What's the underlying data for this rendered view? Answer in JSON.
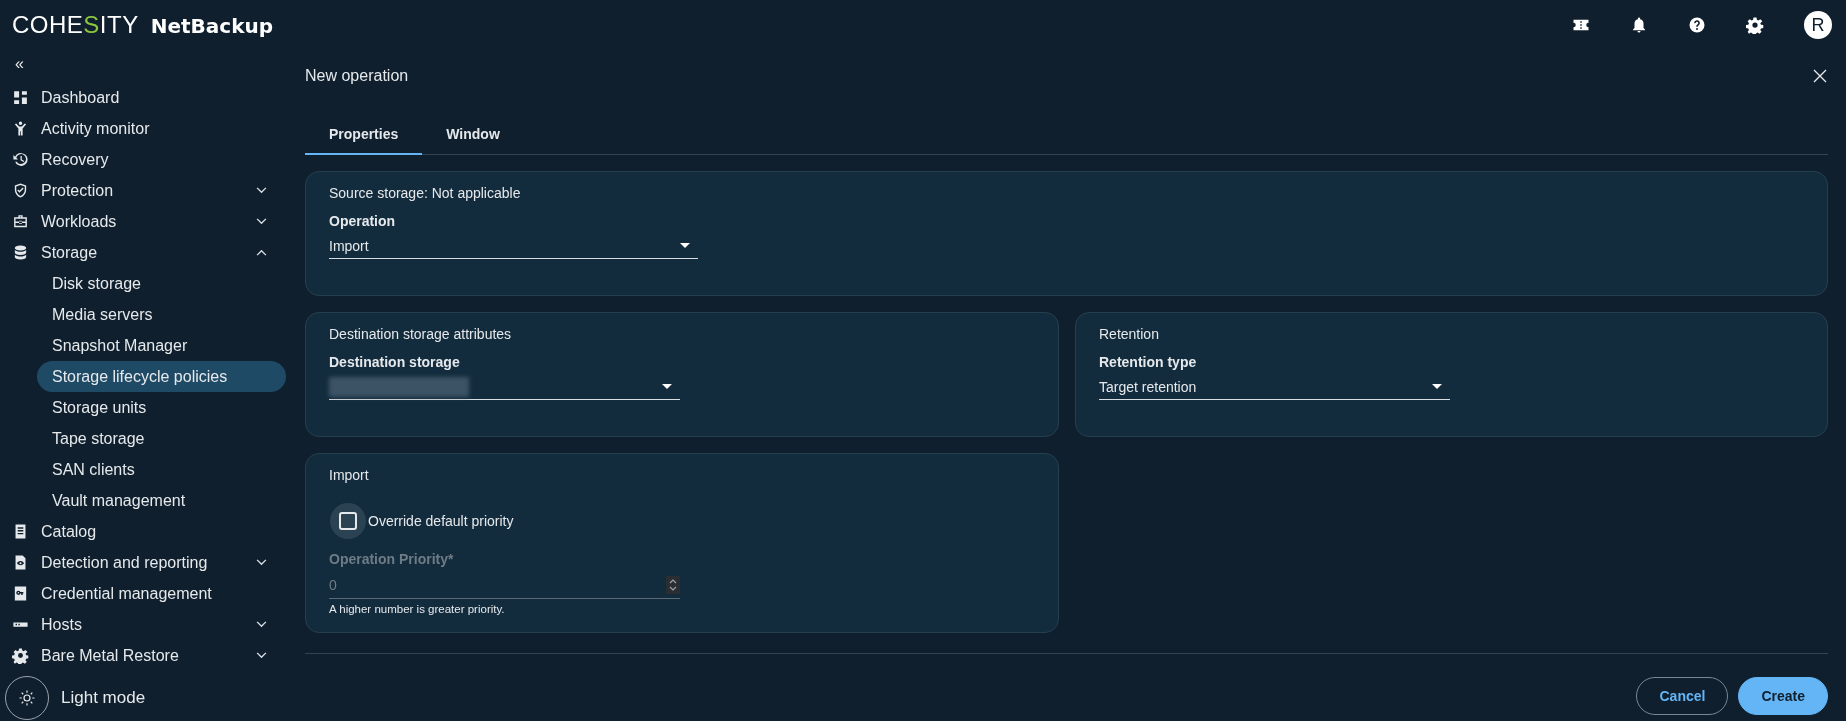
{
  "header": {
    "logo": "COHESITY",
    "product": "NetBackup",
    "avatar": "R"
  },
  "sidebar": {
    "collapse": "«",
    "items": [
      {
        "label": "Dashboard",
        "kind": "link",
        "selected": false
      },
      {
        "label": "Activity monitor",
        "kind": "link",
        "selected": false
      },
      {
        "label": "Recovery",
        "kind": "link",
        "selected": false
      },
      {
        "label": "Protection",
        "kind": "group",
        "expanded": false,
        "selected": false
      },
      {
        "label": "Workloads",
        "kind": "group",
        "expanded": false,
        "selected": false
      },
      {
        "label": "Storage",
        "kind": "group",
        "expanded": true,
        "selected": false,
        "children": [
          {
            "label": "Disk storage",
            "selected": false
          },
          {
            "label": "Media servers",
            "selected": false
          },
          {
            "label": "Snapshot Manager",
            "selected": false
          },
          {
            "label": "Storage lifecycle policies",
            "selected": true
          },
          {
            "label": "Storage units",
            "selected": false
          },
          {
            "label": "Tape storage",
            "selected": false
          },
          {
            "label": "SAN clients",
            "selected": false
          },
          {
            "label": "Vault management",
            "selected": false
          }
        ]
      },
      {
        "label": "Catalog",
        "kind": "link",
        "selected": false
      },
      {
        "label": "Detection and reporting",
        "kind": "group",
        "expanded": false,
        "selected": false
      },
      {
        "label": "Credential management",
        "kind": "link",
        "selected": false
      },
      {
        "label": "Hosts",
        "kind": "group",
        "expanded": false,
        "selected": false
      },
      {
        "label": "Bare Metal Restore",
        "kind": "group",
        "expanded": false,
        "selected": false
      }
    ],
    "theme_toggle": "Light mode"
  },
  "dialog": {
    "title": "New operation",
    "tabs": [
      {
        "label": "Properties",
        "selected": true
      },
      {
        "label": "Window",
        "selected": false
      }
    ],
    "source": {
      "title": "Source storage: Not applicable",
      "field_label": "Operation",
      "value": "Import"
    },
    "destination": {
      "title": "Destination storage attributes",
      "field_label": "Destination storage",
      "value_redacted": true
    },
    "retention": {
      "title": "Retention",
      "field_label": "Retention type",
      "value": "Target retention"
    },
    "import": {
      "title": "Import",
      "checkbox": {
        "label": "Override default priority",
        "checked": false
      },
      "priority": {
        "label": "Operation Priority*",
        "value": "0",
        "disabled": true,
        "hint": "A higher number is greater priority."
      }
    },
    "buttons": [
      {
        "label": "Cancel",
        "kind": "secondary"
      },
      {
        "label": "Create",
        "kind": "primary"
      }
    ]
  }
}
